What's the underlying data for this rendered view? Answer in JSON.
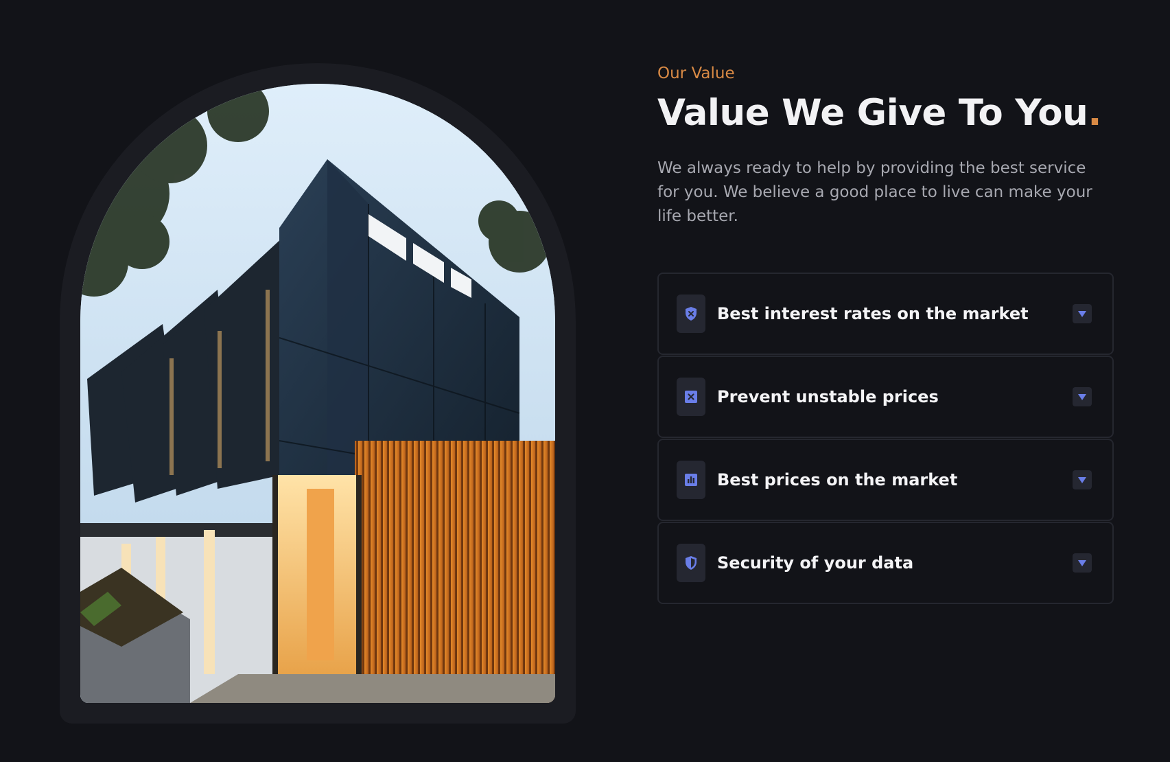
{
  "colors": {
    "background": "#121318",
    "accent": "#d98a45",
    "icon": "#6a7ee8",
    "card_border": "#25272f"
  },
  "hero_image": {
    "subject": "modern-house-photo"
  },
  "section": {
    "eyebrow": "Our Value",
    "title": "Value We Give To You",
    "title_dot": ".",
    "description": "We always ready to help by providing the best service for you. We believe a good place to live can make your life better."
  },
  "accordion": [
    {
      "icon": "shield-x-icon",
      "label": "Best interest rates on the market",
      "toggle_icon": "caret-down-icon",
      "expanded": false
    },
    {
      "icon": "x-square-icon",
      "label": "Prevent unstable prices",
      "toggle_icon": "caret-down-icon",
      "expanded": false
    },
    {
      "icon": "bar-chart-icon",
      "label": "Best prices on the market",
      "toggle_icon": "caret-down-icon",
      "expanded": false
    },
    {
      "icon": "shield-half-icon",
      "label": "Security of your data",
      "toggle_icon": "caret-down-icon",
      "expanded": false
    }
  ]
}
